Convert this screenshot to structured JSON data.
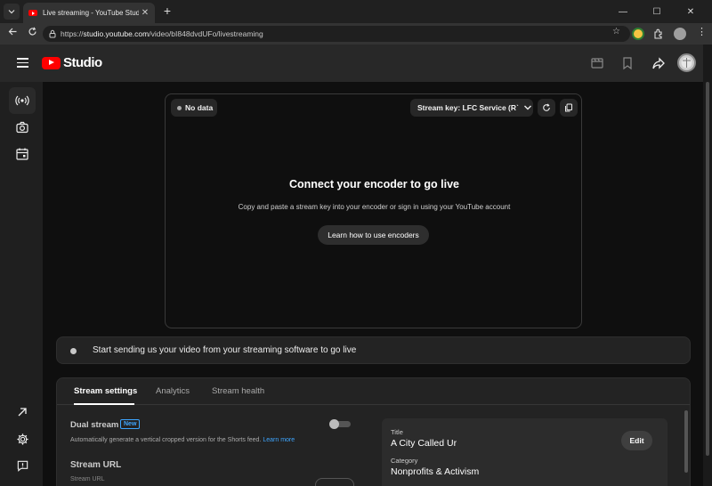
{
  "browser": {
    "tab_title": "Live streaming - YouTube Studio",
    "tab_close": "✕",
    "new_tab": "+",
    "url_host": "studio.youtube.com",
    "url_prefix": "https://",
    "url_path": "/video/bI848dvdUFo/livestreaming",
    "window_controls": [
      "—",
      "☐",
      "✕"
    ]
  },
  "header": {
    "logo_text": "Studio",
    "icons": [
      "clapperboard-icon",
      "bookmark-icon",
      "share-icon"
    ]
  },
  "rail": {
    "items": [
      "live-broadcast-icon",
      "camera-icon",
      "calendar-icon"
    ],
    "bottom": [
      "external-link-icon",
      "gear-icon",
      "feedback-icon"
    ]
  },
  "preview": {
    "status_chip": "No data",
    "stream_key": "Stream key: LFC Service (Rˋ",
    "title": "Connect your encoder to go live",
    "subtitle": "Copy and paste a stream key into your encoder or sign in using your YouTube account",
    "learn_button": "Learn how to use encoders"
  },
  "status": {
    "message": "Start sending us your video from your streaming software to go live"
  },
  "settings": {
    "tabs": [
      "Stream settings",
      "Analytics",
      "Stream health"
    ],
    "active_tab": 0,
    "dual_stream_label": "Dual stream",
    "new_badge": "New",
    "dual_stream_desc": "Automatically generate a vertical cropped version for the Shorts feed.",
    "learn_more": "Learn more",
    "dual_stream_enabled": false,
    "stream_url_label": "Stream URL",
    "stream_url_sublabel": "Stream URL"
  },
  "info": {
    "title_label": "Title",
    "title_value": "A City Called Ur",
    "category_label": "Category",
    "category_value": "Nonprofits & Activism",
    "edit_button": "Edit"
  },
  "colors": {
    "accent_red": "#ff0000",
    "link_blue": "#3ea6ff",
    "bg": "#0f0f0f"
  }
}
